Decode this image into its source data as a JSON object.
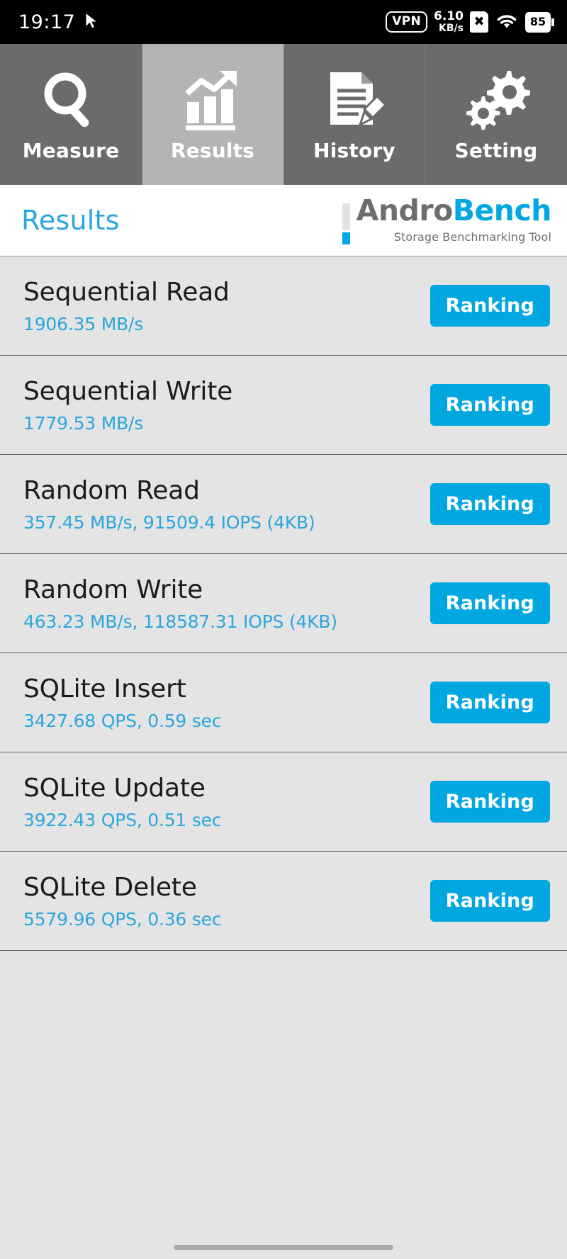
{
  "status_bar": {
    "clock": "19:17",
    "cursor_icon": "mouse-pointer-icon",
    "vpn_label": "VPN",
    "net_speed_value": "6.10",
    "net_speed_unit": "KB/s",
    "sim_icon_label": "✖",
    "wifi_icon": "wifi-icon",
    "battery_level": "85"
  },
  "tabs": [
    {
      "label": "Measure",
      "icon": "magnifier-icon",
      "active": false
    },
    {
      "label": "Results",
      "icon": "bar-chart-icon",
      "active": true
    },
    {
      "label": "History",
      "icon": "document-pencil-icon",
      "active": false
    },
    {
      "label": "Setting",
      "icon": "gears-icon",
      "active": false
    }
  ],
  "header": {
    "title": "Results",
    "brand_prefix": "Andro",
    "brand_suffix": "Bench",
    "brand_subtitle": "Storage Benchmarking Tool"
  },
  "results": [
    {
      "name": "Sequential Read",
      "value": "1906.35 MB/s",
      "button": "Ranking"
    },
    {
      "name": "Sequential Write",
      "value": "1779.53 MB/s",
      "button": "Ranking"
    },
    {
      "name": "Random Read",
      "value": "357.45 MB/s, 91509.4 IOPS (4KB)",
      "button": "Ranking"
    },
    {
      "name": "Random Write",
      "value": "463.23 MB/s, 118587.31 IOPS (4KB)",
      "button": "Ranking"
    },
    {
      "name": "SQLite Insert",
      "value": "3427.68 QPS, 0.59 sec",
      "button": "Ranking"
    },
    {
      "name": "SQLite Update",
      "value": "3922.43 QPS, 0.51 sec",
      "button": "Ranking"
    },
    {
      "name": "SQLite Delete",
      "value": "5579.96 QPS, 0.36 sec",
      "button": "Ranking"
    }
  ],
  "colors": {
    "accent_blue": "#00a7e1",
    "value_blue": "#2ba6de",
    "tab_inactive": "#6b6b6b",
    "tab_active": "#b4b4b4",
    "list_bg": "#e4e4e4"
  }
}
